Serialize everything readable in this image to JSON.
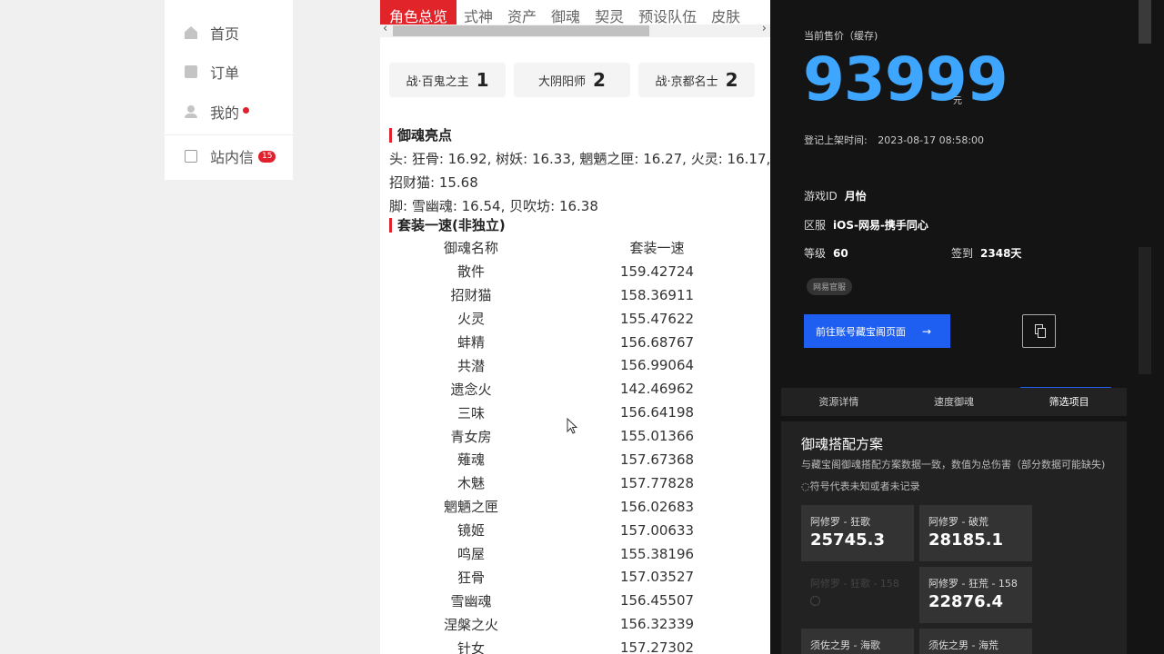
{
  "sidebar": {
    "items": [
      {
        "label": "首页",
        "icon": "home-icon"
      },
      {
        "label": "订单",
        "icon": "order-icon"
      },
      {
        "label": "我的",
        "icon": "user-icon"
      },
      {
        "label": "站内信",
        "icon": "mail-icon",
        "badge": "15"
      }
    ]
  },
  "tabs": [
    "角色总览",
    "式神",
    "资产",
    "御魂",
    "契灵",
    "预设队伍",
    "皮肤"
  ],
  "cards": [
    {
      "label": "战·百鬼之主",
      "value": "1"
    },
    {
      "label": "大阴阳师",
      "value": "2"
    },
    {
      "label": "战·京都名士",
      "value": "2"
    }
  ],
  "highlights": {
    "title": "御魂亮点",
    "lines": [
      "头: 狂骨: 16.92, 树妖: 16.33, 魍魉之匣: 16.27, 火灵: 16.17,",
      "招财猫: 15.68",
      "脚: 雪幽魂: 16.54, 贝吹坊: 16.38"
    ]
  },
  "speed_table": {
    "title": "套装一速(非独立)",
    "headers": [
      "御魂名称",
      "套装一速"
    ],
    "rows": [
      [
        "散件",
        "159.42724"
      ],
      [
        "招财猫",
        "158.36911"
      ],
      [
        "火灵",
        "155.47622"
      ],
      [
        "蚌精",
        "156.68767"
      ],
      [
        "共潜",
        "156.99064"
      ],
      [
        "遗念火",
        "142.46962"
      ],
      [
        "三味",
        "156.64198"
      ],
      [
        "青女房",
        "155.01366"
      ],
      [
        "薙魂",
        "157.67368"
      ],
      [
        "木魅",
        "157.77828"
      ],
      [
        "魍魉之匣",
        "156.02683"
      ],
      [
        "镜姬",
        "157.00633"
      ],
      [
        "鸣屋",
        "155.38196"
      ],
      [
        "狂骨",
        "157.03527"
      ],
      [
        "雪幽魂",
        "156.45507"
      ],
      [
        "涅槃之火",
        "156.32339"
      ],
      [
        "针女",
        "157.27302"
      ]
    ]
  },
  "right_panel": {
    "price_label": "当前售价（缓存)",
    "price": "93999",
    "price_unit": "元",
    "listing_label": "登记上架时间:",
    "listing_time": "2023-08-17 08:58:00",
    "game_id_label": "游戏ID",
    "game_id": "月怡",
    "server_label": "区服",
    "server": "iOS-网易-携手同心",
    "level_label": "等级",
    "level": "60",
    "checkin_label": "签到",
    "checkin": "2348天",
    "tag": "网易官服",
    "go_button": "前往账号藏宝阁页面",
    "panel_tabs": [
      "资源详情",
      "速度御魂",
      "筛选项目"
    ],
    "plan_title": "御魂搭配方案",
    "plan_subtitle": "与藏宝阁御魂搭配方案数据一致，数值为总伤害（部分数据可能缺失)",
    "plan_note": "◌符号代表未知或者未记录",
    "plans": [
      {
        "name": "阿修罗 - 狂歌",
        "value": "25745.3"
      },
      {
        "name": "阿修罗 - 破荒",
        "value": "28185.1"
      },
      {
        "name": "阿修罗 - 狂歌 - 158",
        "value": ""
      },
      {
        "name": "阿修罗 - 狂荒 - 158",
        "value": "22876.4"
      },
      {
        "name": "须佐之男 - 海歌",
        "value": ""
      },
      {
        "name": "须佐之男 - 海荒",
        "value": ""
      }
    ]
  },
  "colors": {
    "accent_red": "#e1232a",
    "price_blue": "#3ea6ff",
    "button_blue": "#1e5ef0",
    "dark_bg": "#141414"
  }
}
